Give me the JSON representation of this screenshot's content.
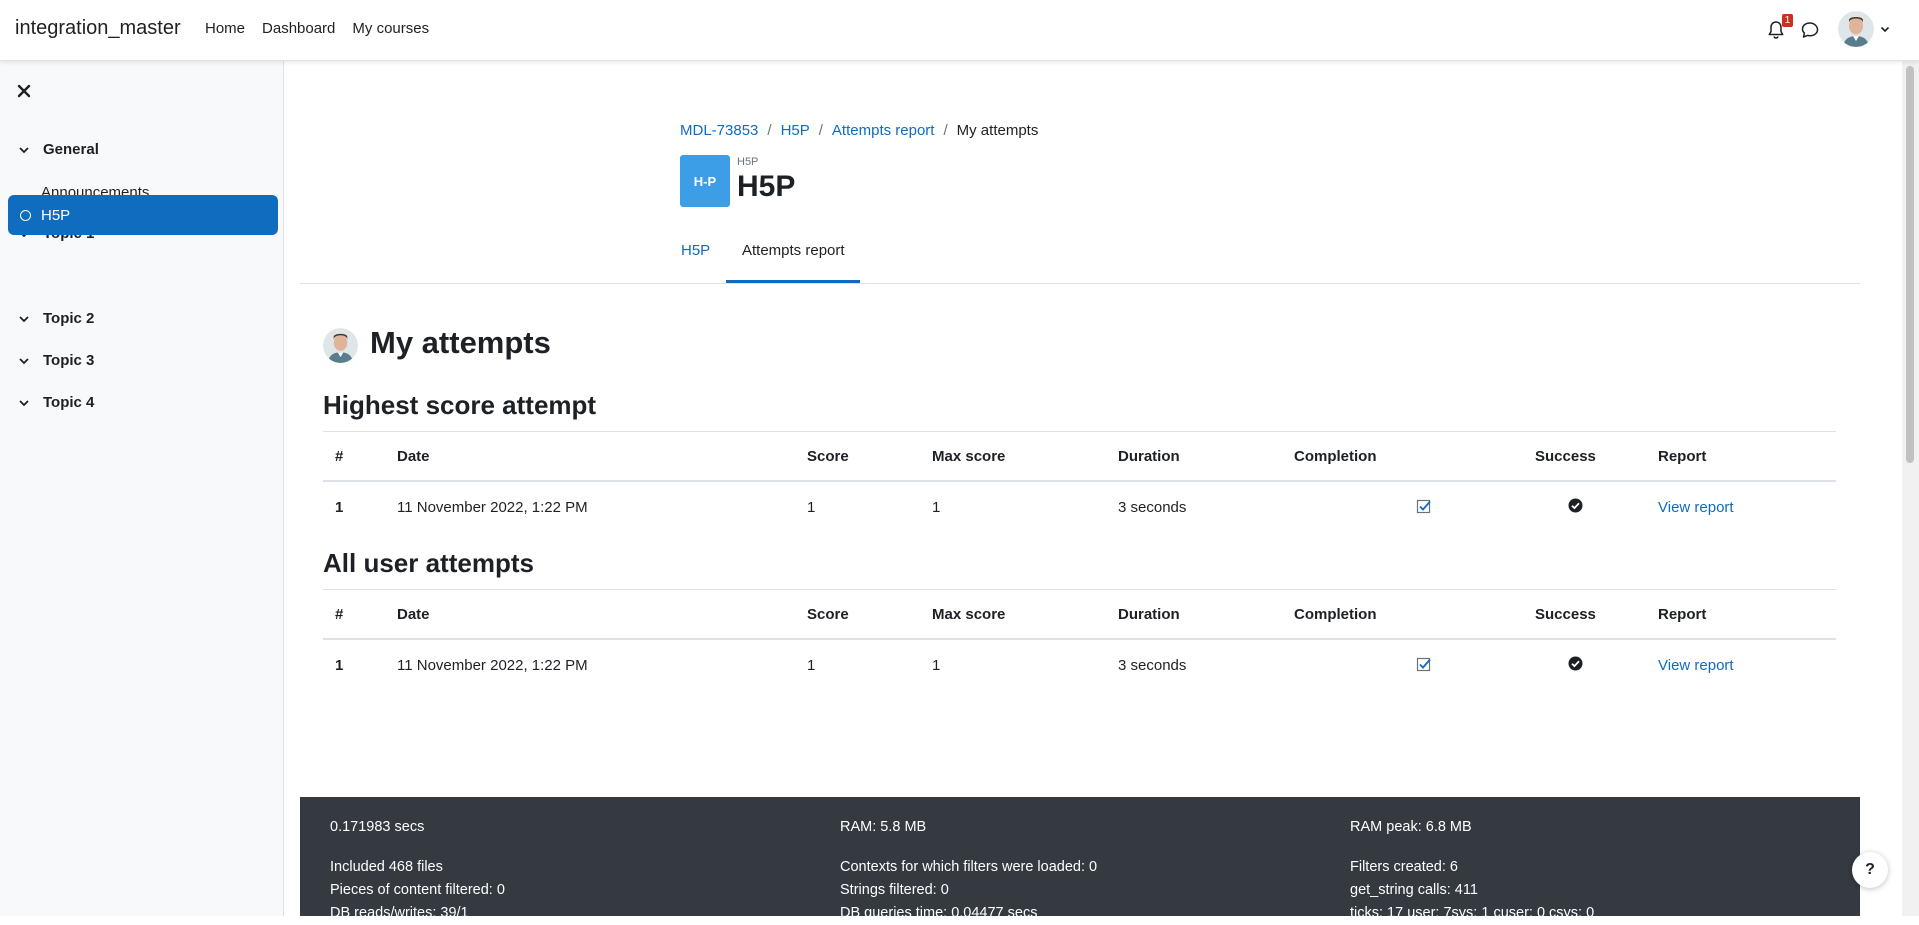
{
  "navbar": {
    "brand": "integration_master",
    "links": [
      "Home",
      "Dashboard",
      "My courses"
    ],
    "notification_count": "1"
  },
  "drawer": {
    "sections": [
      {
        "label": "General",
        "items": [
          "Announcements"
        ]
      },
      {
        "label": "Topic 1",
        "items": [
          "H5P"
        ],
        "active": "H5P"
      },
      {
        "label": "Topic 2",
        "items": []
      },
      {
        "label": "Topic 3",
        "items": []
      },
      {
        "label": "Topic 4",
        "items": []
      }
    ]
  },
  "breadcrumb": [
    "MDL-73853",
    "H5P",
    "Attempts report",
    "My attempts"
  ],
  "module": {
    "logo_text": "H-P",
    "type_label": "H5P",
    "title": "H5P"
  },
  "tabs": [
    {
      "label": "H5P",
      "active": false
    },
    {
      "label": "Attempts report",
      "active": true
    }
  ],
  "content": {
    "heading": "My attempts",
    "columns": [
      "#",
      "Date",
      "Score",
      "Max score",
      "Duration",
      "Completion",
      "Success",
      "Report"
    ],
    "highest": {
      "heading": "Highest score attempt",
      "rows": [
        {
          "num": "1",
          "date": "11 November 2022, 1:22 PM",
          "score": "1",
          "max": "1",
          "duration": "3 seconds",
          "report": "View report"
        }
      ]
    },
    "all": {
      "heading": "All user attempts",
      "rows": [
        {
          "num": "1",
          "date": "11 November 2022, 1:22 PM",
          "score": "1",
          "max": "1",
          "duration": "3 seconds",
          "report": "View report"
        }
      ]
    }
  },
  "footer": {
    "col1": [
      "0.171983 secs",
      "Included 468 files",
      "Pieces of content filtered: 0",
      "DB reads/writes: 39/1"
    ],
    "col2": [
      "RAM: 5.8 MB",
      "Contexts for which filters were loaded: 0",
      "Strings filtered: 0",
      "DB queries time: 0.04477 secs"
    ],
    "col3": [
      "RAM peak: 6.8 MB",
      "Filters created: 6",
      "get_string calls: 411",
      "ticks: 17 user: 7sys: 1 cuser: 0 csys: 0"
    ]
  },
  "help_button": "?",
  "colors": {
    "primary": "#0f6cbf",
    "footer_bg": "#343a40",
    "h5p_blue": "#3d9ee8",
    "drawer_bg": "#f8f9fa"
  }
}
